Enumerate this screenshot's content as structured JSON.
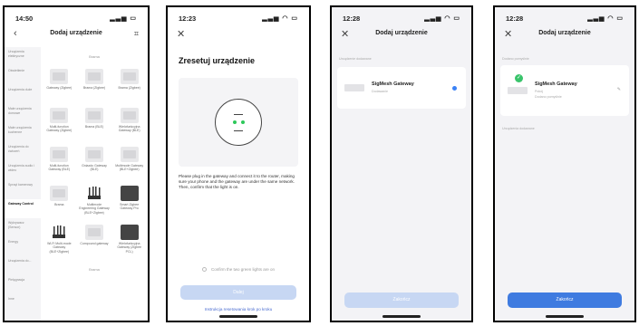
{
  "screen1": {
    "time": "14:50",
    "title": "Dodaj urządzenie",
    "categories": [
      "Urządzenia elektryczne",
      "Oświetlenie",
      "Urządzenia duże",
      "Małe urządzenia domowe",
      "Małe urządzenia kuchenne",
      "Urządzenia do ćwiczeń",
      "Urządzenia audio i wideo",
      "Sprzęt kamerowy",
      "Gateway Control",
      "Wykrywacz (Sensor)",
      "Energy",
      "Urządzenia do...",
      "Pielęgnacja",
      "Inne"
    ],
    "active_category": "Gateway Control",
    "grid_header": "Brama",
    "devices": [
      {
        "label": "Gateway (Zigbee)"
      },
      {
        "label": "Brama (Zigbee)"
      },
      {
        "label": "Brama (Zigbee)"
      },
      {
        "label": "Multi-function Gateway (Zigbee)"
      },
      {
        "label": "Brama (BLE)"
      },
      {
        "label": "Wielofunkcyjna Gateway (BLE)"
      },
      {
        "label": "Multi-function Gateway (BLE)"
      },
      {
        "label": "Gniazdo Gateway (BLE)"
      },
      {
        "label": "Multimode Gateway (BLE+Zigbee)"
      },
      {
        "label": "Brama"
      },
      {
        "label": "Multimode Engineering Gateway (BLE+Zigbee)"
      },
      {
        "label": "Smart Zigbee Gateway Pro"
      },
      {
        "label": "Wi-Fi Multi-mode Gateway (BLE+Zigbee)"
      },
      {
        "label": "Compound gateway"
      },
      {
        "label": "Wielofunkcyjna Gateway (Zigbee PCL)"
      }
    ],
    "footer": "Brama"
  },
  "screen2": {
    "time": "12:23",
    "title": "Zresetuj urządzenie",
    "instructions": "Please plug in the gateway and connect it to the router, making sure your phone and the gateway are under the same network. Then, confirm that the light is on.",
    "confirm_label": "Confirm the two green lights are on",
    "next_button": "Dalej",
    "link": "Instrukcja resetowania krok po kroku"
  },
  "screen3": {
    "time": "12:28",
    "title": "Dodaj urządzenie",
    "section": "Urządzenie dodawane",
    "device_name": "SigMesh Gateway",
    "device_status": "Dodawanie",
    "button": "Zakończ"
  },
  "screen4": {
    "time": "12:28",
    "title": "Dodaj urządzenie",
    "section1": "Dodano pomyślnie",
    "device_name": "SigMesh Gateway",
    "device_room": "Pokój",
    "device_status": "Dodano pomyślnie",
    "section2": "Urządzenia dodawane",
    "button": "Zakończ"
  },
  "colors": {
    "accent": "#3f7be0",
    "accent_disabled": "#c7d7f3",
    "success": "#39c46b",
    "led": "#2dc85a"
  },
  "icons": [
    "signal-icon",
    "wifi-icon",
    "battery-icon",
    "back-icon",
    "scan-icon",
    "close-icon",
    "edit-icon",
    "check-icon"
  ]
}
